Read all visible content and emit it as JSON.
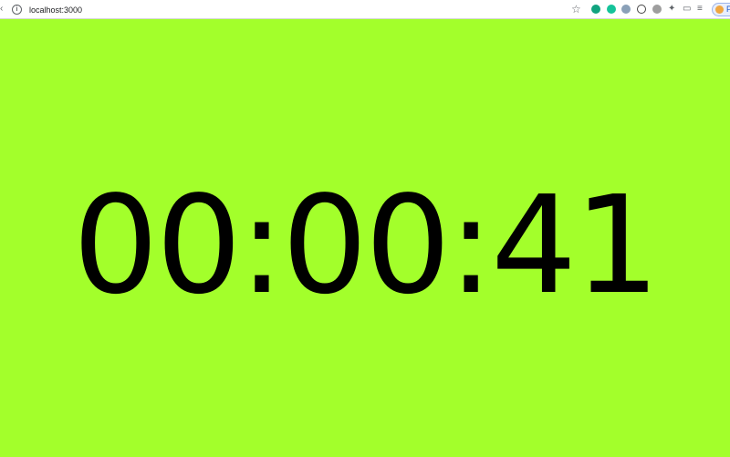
{
  "browser": {
    "url": "localhost:3000",
    "profile_letter": "P"
  },
  "timer": {
    "display": "00:00:41",
    "background_color": "#a3ff2b",
    "text_color": "#000000"
  },
  "extensions": [
    "green-shield-icon",
    "grammarly-icon",
    "script-icon",
    "no-entry-icon",
    "abp-icon",
    "puzzle-icon",
    "cast-icon",
    "queue-icon"
  ]
}
